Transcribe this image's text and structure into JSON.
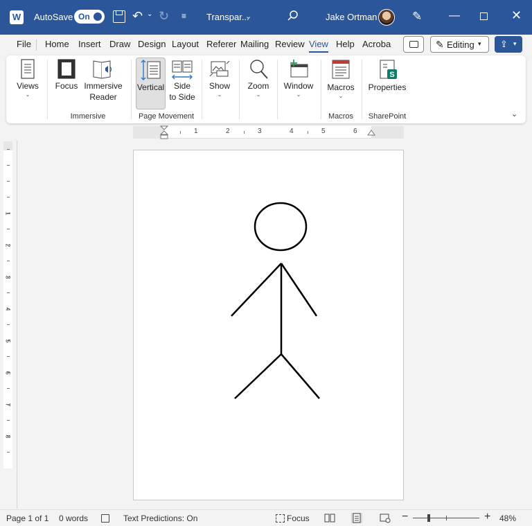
{
  "titlebar": {
    "autosave_label": "AutoSave",
    "autosave_state": "On",
    "doc_title": "Transpar...",
    "user_name": "Jake Ortman",
    "accent_color": "#2b579a"
  },
  "tabs": [
    "File",
    "Home",
    "Insert",
    "Draw",
    "Design",
    "Layout",
    "Referer",
    "Mailing",
    "Review",
    "View",
    "Help",
    "Acroba"
  ],
  "active_tab": "View",
  "editing_label": "Editing",
  "ribbon": {
    "views": "Views",
    "focus": "Focus",
    "immersive_reader_1": "Immersive",
    "immersive_reader_2": "Reader",
    "vertical": "Vertical",
    "side_1": "Side",
    "side_2": "to Side",
    "show": "Show",
    "zoom": "Zoom",
    "window": "Window",
    "macros": "Macros",
    "properties": "Properties",
    "groups": {
      "immersive": "Immersive",
      "page_movement": "Page Movement",
      "macros": "Macros",
      "sharepoint": "SharePoint"
    }
  },
  "ruler": {
    "h_numbers": [
      "1",
      "2",
      "3",
      "4",
      "5",
      "6"
    ],
    "v_numbers": [
      "1",
      "2",
      "3",
      "4",
      "5",
      "6",
      "7",
      "8"
    ]
  },
  "status": {
    "page": "Page 1 of 1",
    "words": "0 words",
    "predictions": "Text Predictions: On",
    "focus": "Focus",
    "zoom": "48%",
    "zoom_level": 0.48
  }
}
